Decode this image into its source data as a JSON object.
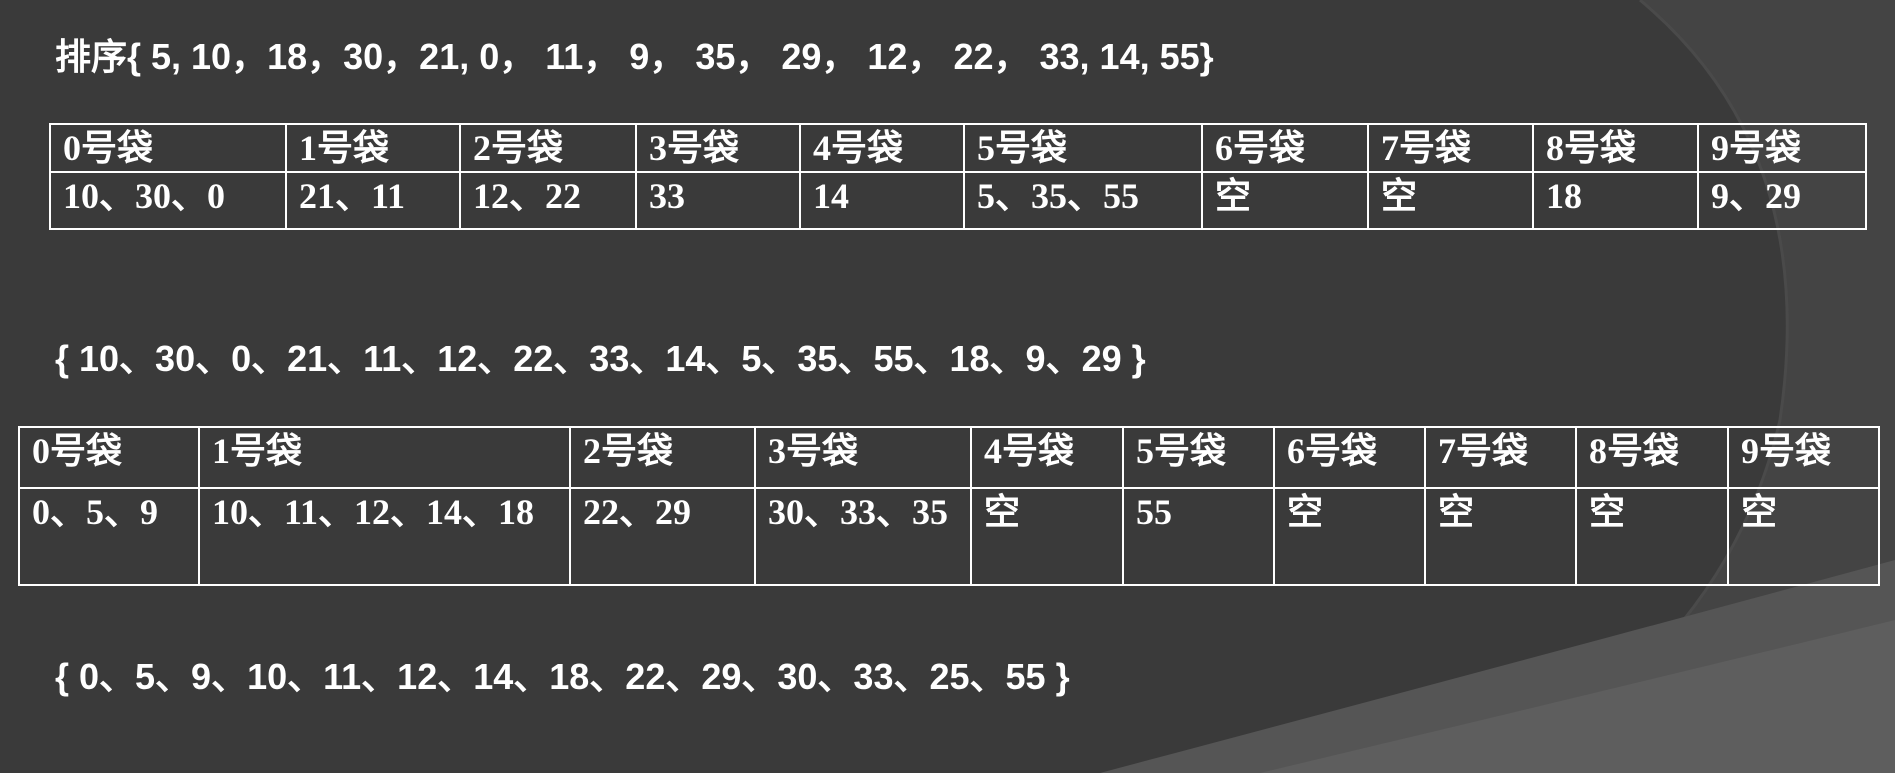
{
  "slide": {
    "line1": "排序{ 5, 10，18，30，21, 0， 11， 9， 35， 29， 12， 22， 33, 14, 55}",
    "line2": "{ 10、30、0、21、11、12、22、33、14、5、35、55、18、9、29 }",
    "line3": "{ 0、5、9、10、11、12、14、18、22、29、30、33、25、55 }"
  },
  "table1": {
    "headers": [
      "0号袋",
      "1号袋",
      "2号袋",
      "3号袋",
      "4号袋",
      "5号袋",
      "6号袋",
      "7号袋",
      "8号袋",
      "9号袋"
    ],
    "values": [
      "10、30、0",
      "21、11",
      "12、22",
      "33",
      "14",
      "5、35、55",
      "空",
      "空",
      "18",
      "9、29"
    ]
  },
  "table2": {
    "headers": [
      "0号袋",
      "1号袋",
      "2号袋",
      "3号袋",
      "4号袋",
      "5号袋",
      "6号袋",
      "7号袋",
      "8号袋",
      "9号袋"
    ],
    "values": [
      "0、5、9",
      "10、11、12、14、18",
      "22、29",
      "30、33、35",
      "空",
      "55",
      "空",
      "空",
      "空",
      "空"
    ]
  },
  "colors": {
    "background": "#3a3a3a",
    "text": "#ffffff",
    "table_border": "#ffffff"
  }
}
